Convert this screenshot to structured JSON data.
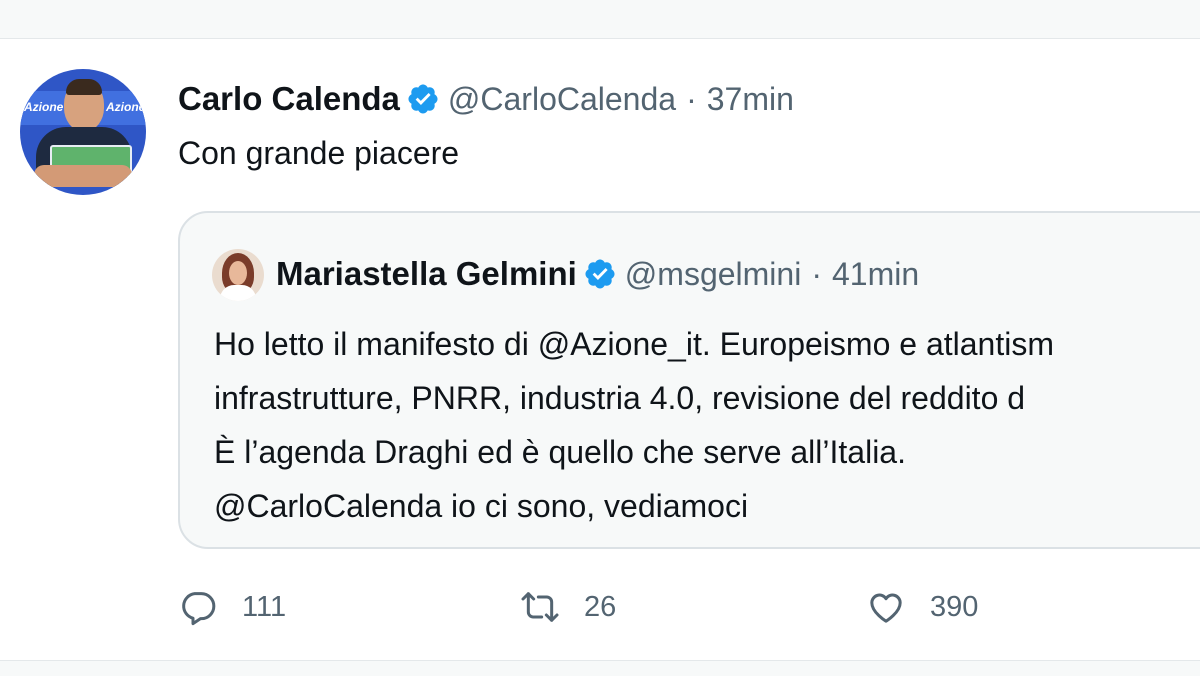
{
  "tweet": {
    "author_name": "Carlo Calenda",
    "author_handle": "@CarloCalenda",
    "time": "37min",
    "separator": "·",
    "text": "Con grande piacere",
    "verified_icon": "verified-badge-icon",
    "avatar_logo_text": "Azione"
  },
  "quoted": {
    "author_name": "Mariastella Gelmini",
    "author_handle": "@msgelmini",
    "time": "41min",
    "separator": "·",
    "lines": [
      "Ho letto il manifesto di @Azione_it. Europeismo e atlantism",
      "infrastrutture, PNRR, industria 4.0, revisione del reddito d",
      "È l’agenda Draghi ed è quello che serve all’Italia.",
      "@CarloCalenda io ci sono, vediamoci"
    ]
  },
  "actions": {
    "reply": {
      "icon": "reply-icon",
      "count": "111"
    },
    "retweet": {
      "icon": "retweet-icon",
      "count": "26"
    },
    "like": {
      "icon": "like-icon",
      "count": "390"
    }
  },
  "colors": {
    "verified": "#1d9bf0",
    "secondary_text": "#536471",
    "primary_text": "#0f1419",
    "quote_border": "#dbe1e5"
  }
}
